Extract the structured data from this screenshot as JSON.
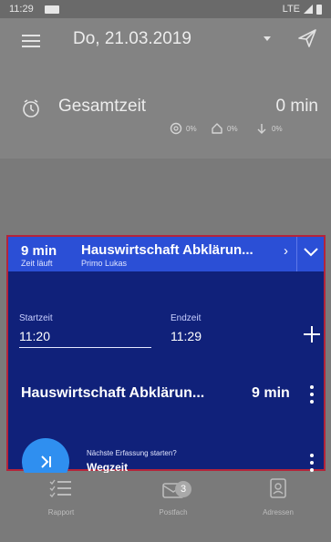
{
  "statusbar": {
    "time": "11:29",
    "network": "LTE"
  },
  "header": {
    "date": "Do, 21.03.2019"
  },
  "summary": {
    "label": "Gesamtzeit",
    "value": "0 min",
    "stats": [
      {
        "icon": "hand-coins-icon",
        "value": "0%"
      },
      {
        "icon": "home-icon",
        "value": "0%"
      },
      {
        "icon": "arrow-down-icon",
        "value": "0%"
      }
    ]
  },
  "active_entry": {
    "time": "9 min",
    "status": "Zeit läuft",
    "title": "Hauswirtschaft Abklärun...",
    "person": "Primo Lukas"
  },
  "times": {
    "start_label": "Startzeit",
    "start_value": "11:20",
    "end_label": "Endzeit",
    "end_value": "11:29"
  },
  "task": {
    "title": "Hauswirtschaft Abklärun...",
    "time": "9 min"
  },
  "next": {
    "label": "Nächste Erfassung starten?",
    "value": "Wegzeit"
  },
  "tabs": [
    {
      "label": "Rapport"
    },
    {
      "label": "Postfach",
      "badge": "3"
    },
    {
      "label": "Adressen"
    }
  ],
  "colors": {
    "panel": "#10217a",
    "header": "#2b4fd6",
    "accent": "#2f8ff0",
    "border": "#b4243a"
  }
}
